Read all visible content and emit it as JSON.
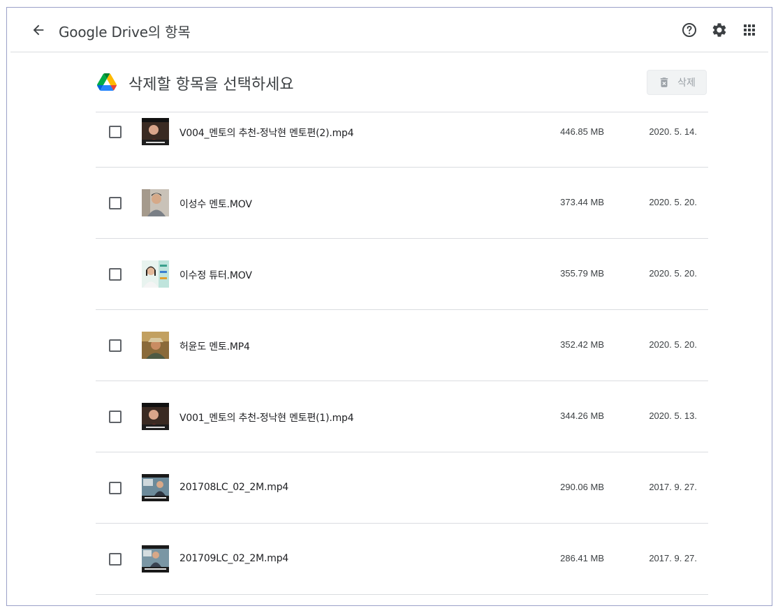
{
  "header": {
    "title": "Google Drive의 항목",
    "icons": [
      "arrow-back-icon",
      "help-icon",
      "settings-icon",
      "apps-grid-icon"
    ]
  },
  "main": {
    "heading": "삭제할 항목을 선택하세요",
    "delete_button": "삭제",
    "delete_button_disabled": true
  },
  "files": [
    {
      "name": "V004_멘토의 추천-정낙현 멘토편(2).mp4",
      "size": "446.85 MB",
      "date": "2020. 5. 14.",
      "thumb": "video-thumb-mentor-red"
    },
    {
      "name": "이성수 멘토.MOV",
      "size": "373.44 MB",
      "date": "2020. 5. 20.",
      "thumb": "video-thumb-portrait-man"
    },
    {
      "name": "이수정 튜터.MOV",
      "size": "355.79 MB",
      "date": "2020. 5. 20.",
      "thumb": "video-thumb-portrait-woman"
    },
    {
      "name": "허윤도 멘토.MP4",
      "size": "352.42 MB",
      "date": "2020. 5. 20.",
      "thumb": "video-thumb-hat-man"
    },
    {
      "name": "V001_멘토의 추천-정낙현 멘토편(1).mp4",
      "size": "344.26 MB",
      "date": "2020. 5. 13.",
      "thumb": "video-thumb-mentor-red"
    },
    {
      "name": "201708LC_02_2M.mp4",
      "size": "290.06 MB",
      "date": "2017. 9. 27.",
      "thumb": "video-thumb-lecture"
    },
    {
      "name": "201709LC_02_2M.mp4",
      "size": "286.41 MB",
      "date": "2017. 9. 27.",
      "thumb": "video-thumb-lecture"
    }
  ],
  "colors": {
    "border": "#dadce0",
    "text": "#202124",
    "icon": "#5f6368",
    "disabled": "#9aa0a6"
  }
}
